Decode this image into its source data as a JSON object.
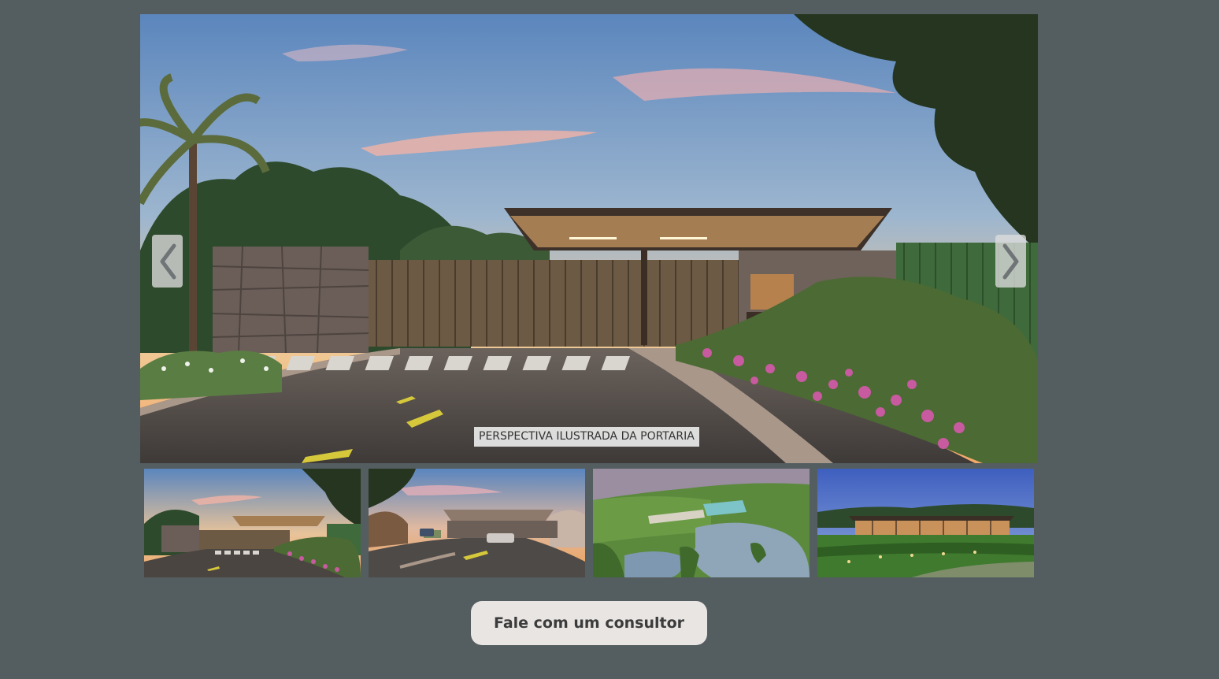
{
  "gallery": {
    "main_caption": "PERSPECTIVA ILUSTRADA DA PORTARIA",
    "prev_icon": "chevron-left-icon",
    "next_icon": "chevron-right-icon",
    "active_index": 0,
    "thumbnails": [
      {
        "scene": "gatehouse-sunset-front"
      },
      {
        "scene": "gatehouse-sunset-road-with-cars"
      },
      {
        "scene": "aerial-lake-and-club"
      },
      {
        "scene": "clubhouse-lawn-dusk"
      }
    ]
  },
  "cta": {
    "label": "Fale com um consultor"
  },
  "colors": {
    "background": "#545d60",
    "button_bg": "#e9e5e3",
    "button_text": "#3c3c3c",
    "arrow_bg": "#dcdcdc",
    "caption_bg": "#e8e8e8"
  }
}
